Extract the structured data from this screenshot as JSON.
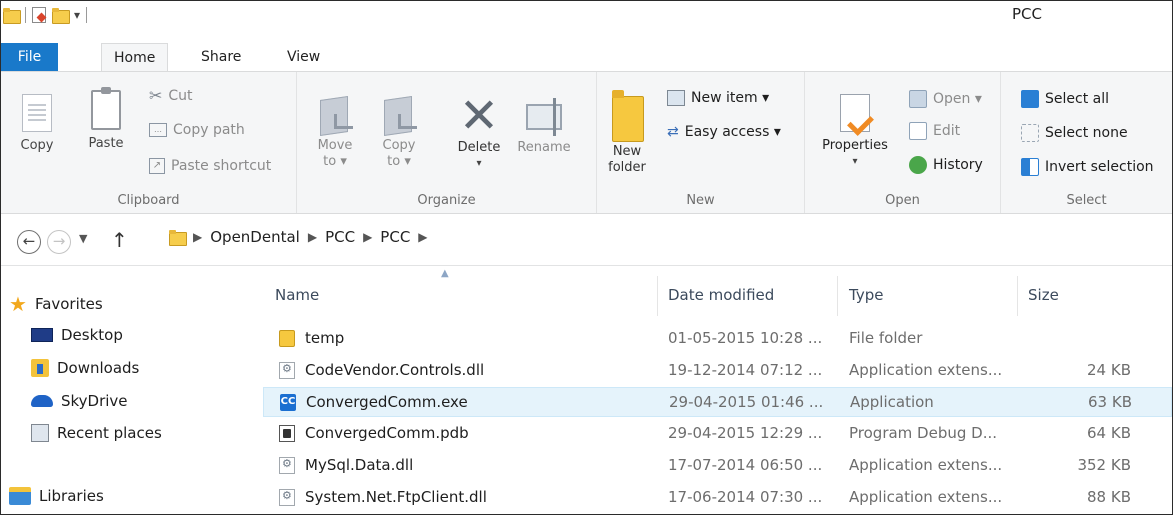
{
  "window": {
    "title": "PCC"
  },
  "ribbon_tabs": [
    "File",
    "Home",
    "Share",
    "View"
  ],
  "clipboard": {
    "copy": "Copy",
    "paste": "Paste",
    "cut": "Cut",
    "copy_path": "Copy path",
    "paste_shortcut": "Paste shortcut",
    "label": "Clipboard"
  },
  "organize": {
    "move_to_1": "Move",
    "move_to_2": "to ▾",
    "copy_to_1": "Copy",
    "copy_to_2": "to ▾",
    "delete": "Delete",
    "delete_arrow": "▾",
    "rename": "Rename",
    "label": "Organize"
  },
  "new_group": {
    "new_folder_1": "New",
    "new_folder_2": "folder",
    "new_item": "New item ▾",
    "easy_access": "Easy access ▾",
    "label": "New"
  },
  "open_group": {
    "properties": "Properties",
    "properties_arrow": "▾",
    "open": "Open ▾",
    "edit": "Edit",
    "history": "History",
    "label": "Open"
  },
  "select_group": {
    "select_all": "Select all",
    "select_none": "Select none",
    "invert": "Invert selection",
    "label": "Select"
  },
  "breadcrumb": [
    "OpenDental",
    "PCC",
    "PCC"
  ],
  "nav": {
    "favorites": "Favorites",
    "desktop": "Desktop",
    "downloads": "Downloads",
    "skydrive": "SkyDrive",
    "recent": "Recent places",
    "libraries": "Libraries"
  },
  "columns": {
    "name": "Name",
    "date": "Date modified",
    "type": "Type",
    "size": "Size"
  },
  "files": [
    {
      "name": "temp",
      "date": "01-05-2015 10:28 ...",
      "type": "File folder",
      "size": "",
      "icon": "folder-icon"
    },
    {
      "name": "CodeVendor.Controls.dll",
      "date": "19-12-2014 07:12 ...",
      "type": "Application extens...",
      "size": "24 KB",
      "icon": "dll-icon"
    },
    {
      "name": "ConvergedComm.exe",
      "date": "29-04-2015 01:46 ...",
      "type": "Application",
      "size": "63 KB",
      "icon": "exe-icon"
    },
    {
      "name": "ConvergedComm.pdb",
      "date": "29-04-2015 12:29 ...",
      "type": "Program Debug D...",
      "size": "64 KB",
      "icon": "pdb-icon"
    },
    {
      "name": "MySql.Data.dll",
      "date": "17-07-2014 06:50 ...",
      "type": "Application extens...",
      "size": "352 KB",
      "icon": "dll-icon"
    },
    {
      "name": "System.Net.FtpClient.dll",
      "date": "17-06-2014 07:30 ...",
      "type": "Application extens...",
      "size": "88 KB",
      "icon": "dll-icon"
    }
  ],
  "exe_badge": "CC"
}
